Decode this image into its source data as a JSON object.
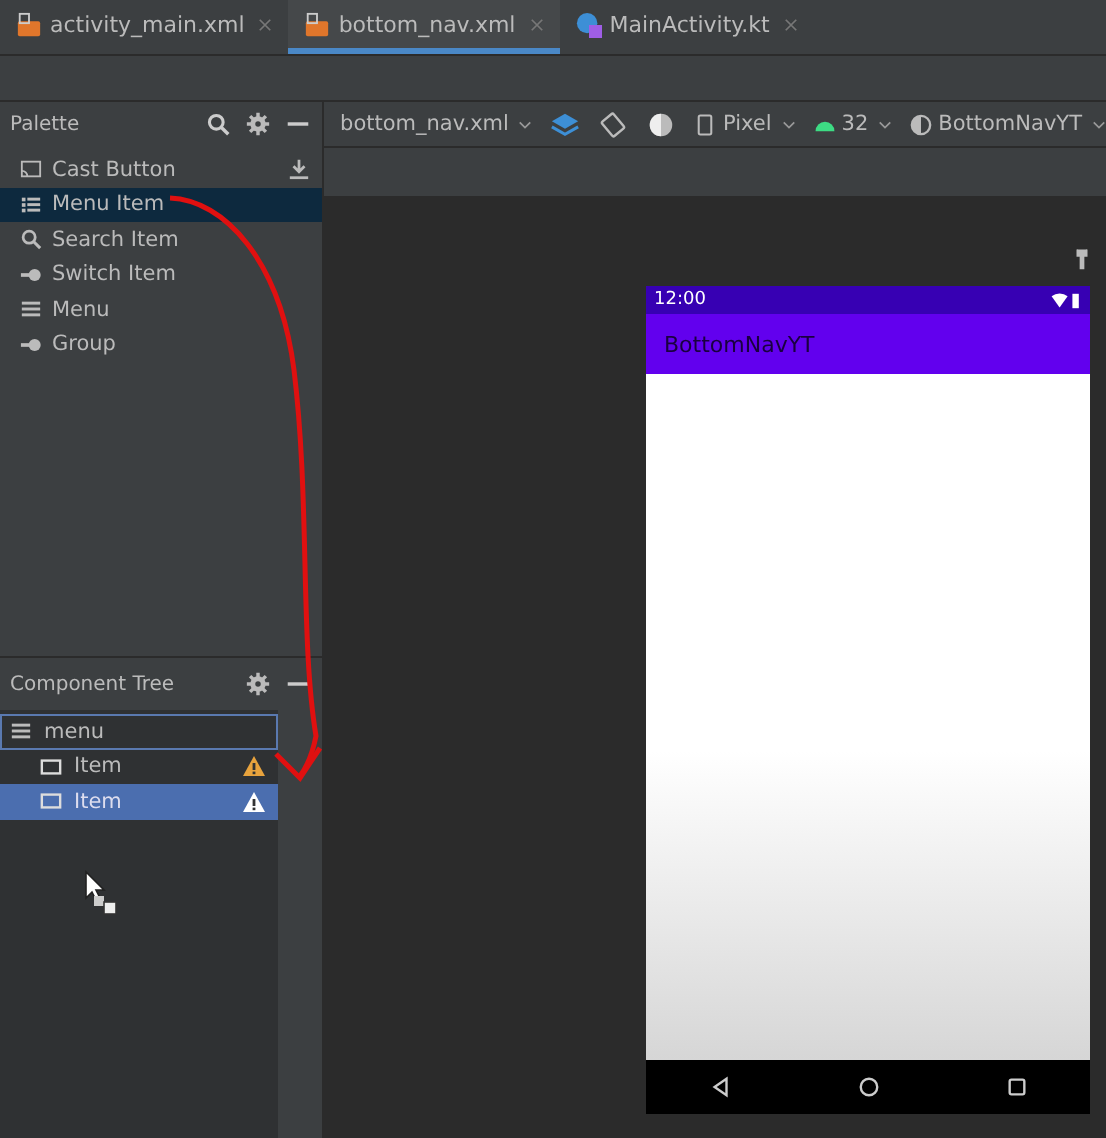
{
  "tabs": [
    {
      "label": "activity_main.xml",
      "kind": "xml",
      "selected": false
    },
    {
      "label": "bottom_nav.xml",
      "kind": "xml",
      "selected": true
    },
    {
      "label": "MainActivity.kt",
      "kind": "kotlin",
      "selected": false
    }
  ],
  "palette": {
    "title": "Palette",
    "items": [
      {
        "label": "Cast Button",
        "kind": "cast",
        "selected": false,
        "downloadable": true
      },
      {
        "label": "Menu Item",
        "kind": "list",
        "selected": true,
        "downloadable": false
      },
      {
        "label": "Search Item",
        "kind": "search",
        "selected": false,
        "downloadable": false
      },
      {
        "label": "Switch Item",
        "kind": "switch",
        "selected": false,
        "downloadable": false
      },
      {
        "label": "Menu",
        "kind": "menu",
        "selected": false,
        "downloadable": false
      },
      {
        "label": "Group",
        "kind": "switch",
        "selected": false,
        "downloadable": false
      }
    ]
  },
  "component_tree": {
    "title": "Component Tree",
    "root": {
      "label": "menu",
      "drop_target": true,
      "children": [
        {
          "label": "Item",
          "selected": false,
          "warning": true
        },
        {
          "label": "Item",
          "selected": true,
          "warning": true
        }
      ]
    }
  },
  "design_toolbar": {
    "file": "bottom_nav.xml",
    "device": "Pixel",
    "api": "32",
    "theme": "BottomNavYT"
  },
  "phone": {
    "time": "12:00",
    "app_title": "BottomNavYT"
  }
}
